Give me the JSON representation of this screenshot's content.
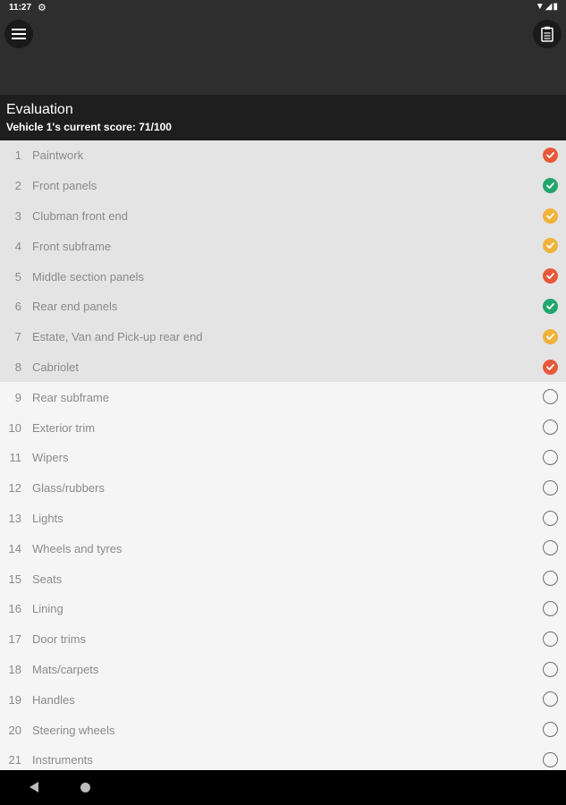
{
  "status_bar": {
    "time": "11:27",
    "gear_icon": "settings-gear",
    "right_icons": "wifi signal battery"
  },
  "app_bar": {
    "menu_icon": "hamburger-menu",
    "action_icon": "clipboard"
  },
  "header": {
    "title": "Evaluation",
    "subtitle": "Vehicle 1's current score: 71/100"
  },
  "items": [
    {
      "num": "1",
      "label": "Paintwork",
      "status": "red"
    },
    {
      "num": "2",
      "label": "Front panels",
      "status": "green"
    },
    {
      "num": "3",
      "label": "Clubman front end",
      "status": "amber"
    },
    {
      "num": "4",
      "label": "Front subframe",
      "status": "amber"
    },
    {
      "num": "5",
      "label": "Middle section panels",
      "status": "red"
    },
    {
      "num": "6",
      "label": "Rear end panels",
      "status": "green"
    },
    {
      "num": "7",
      "label": "Estate, Van and Pick-up rear end",
      "status": "amber"
    },
    {
      "num": "8",
      "label": "Cabriolet",
      "status": "red"
    },
    {
      "num": "9",
      "label": "Rear subframe",
      "status": "empty"
    },
    {
      "num": "10",
      "label": "Exterior trim",
      "status": "empty"
    },
    {
      "num": "11",
      "label": "Wipers",
      "status": "empty"
    },
    {
      "num": "12",
      "label": "Glass/rubbers",
      "status": "empty"
    },
    {
      "num": "13",
      "label": "Lights",
      "status": "empty"
    },
    {
      "num": "14",
      "label": "Wheels and tyres",
      "status": "empty"
    },
    {
      "num": "15",
      "label": "Seats",
      "status": "empty"
    },
    {
      "num": "16",
      "label": "Lining",
      "status": "empty"
    },
    {
      "num": "17",
      "label": "Door trims",
      "status": "empty"
    },
    {
      "num": "18",
      "label": "Mats/carpets",
      "status": "empty"
    },
    {
      "num": "19",
      "label": "Handles",
      "status": "empty"
    },
    {
      "num": "20",
      "label": "Steering wheels",
      "status": "empty"
    },
    {
      "num": "21",
      "label": "Instruments",
      "status": "empty"
    }
  ],
  "colors": {
    "red": "#e8583a",
    "green": "#23a66e",
    "amber": "#f0b23a"
  },
  "nav": {
    "back_icon": "back-triangle",
    "home_icon": "home-circle"
  }
}
